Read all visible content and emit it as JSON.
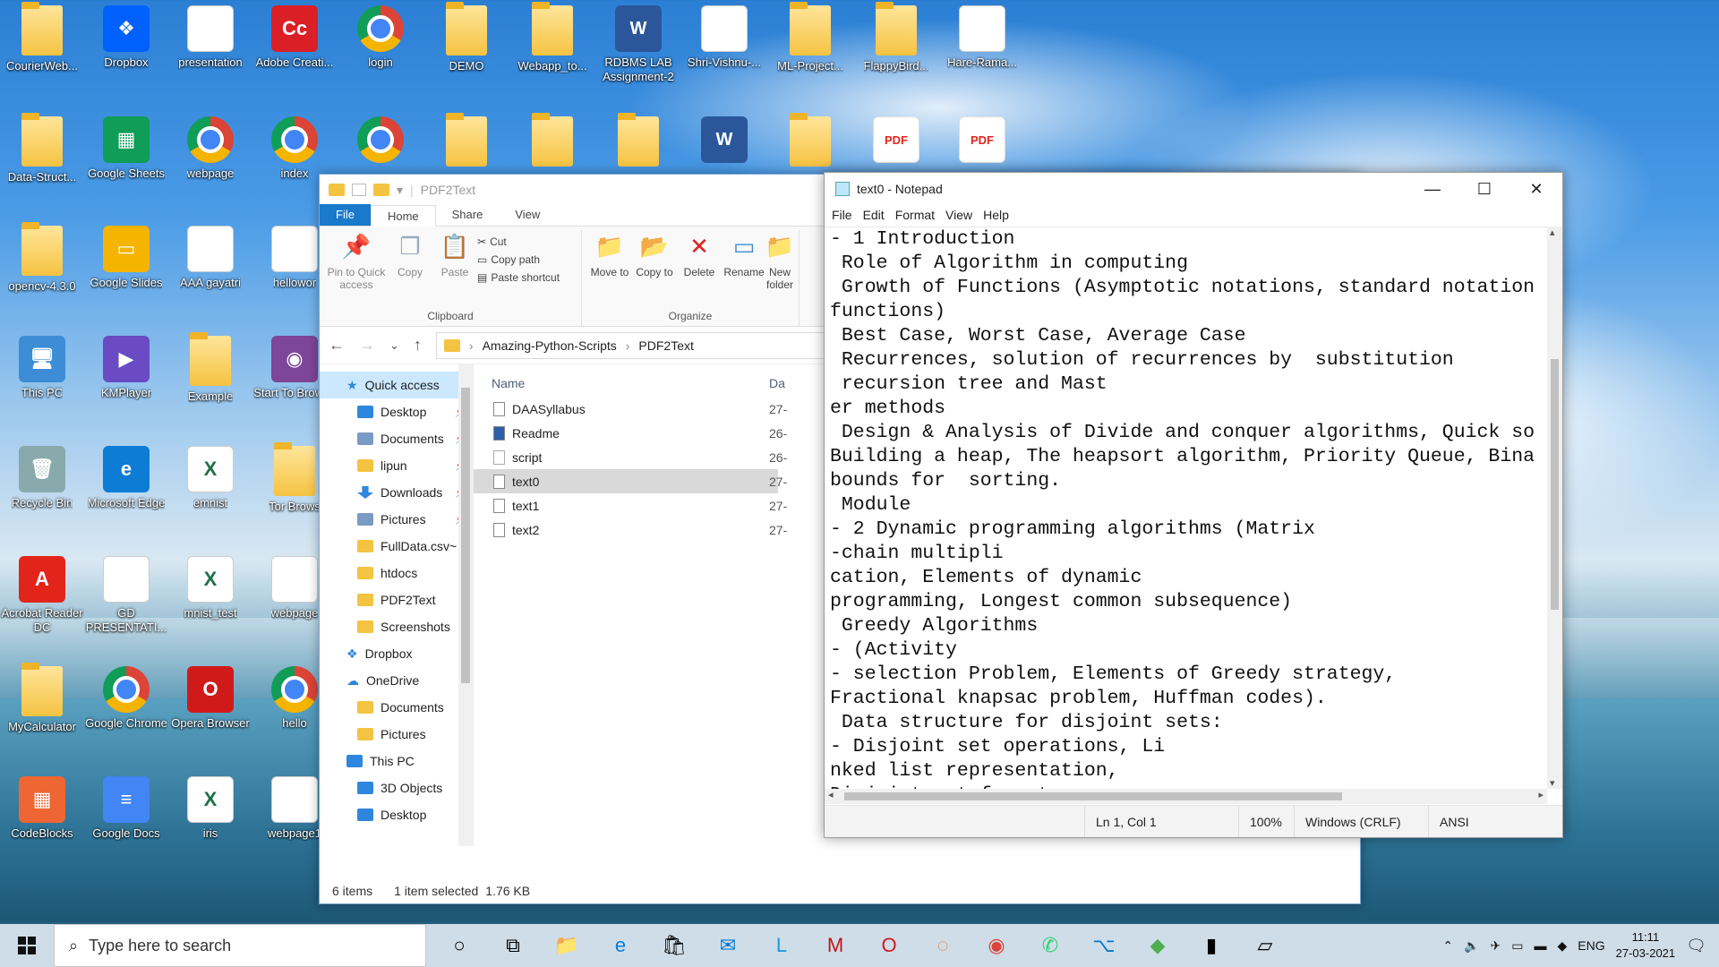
{
  "desktop": {
    "icons": [
      {
        "label": "CourierWeb...",
        "kind": "folder"
      },
      {
        "label": "Dropbox",
        "kind": "dropbox"
      },
      {
        "label": "presentation",
        "kind": "doc"
      },
      {
        "label": "Adobe Creati...",
        "kind": "adobe"
      },
      {
        "label": "login",
        "kind": "chrome"
      },
      {
        "label": "DEMO",
        "kind": "folder"
      },
      {
        "label": "Webapp_to...",
        "kind": "folder"
      },
      {
        "label": "RDBMS LAB Assignment-2",
        "kind": "word"
      },
      {
        "label": "Shri-Vishnu-...",
        "kind": "doc"
      },
      {
        "label": "ML-Project...",
        "kind": "folder"
      },
      {
        "label": "FlappyBird...",
        "kind": "folder"
      },
      {
        "label": "Hare-Rama...",
        "kind": "doc"
      },
      {
        "label": "Data-Struct...",
        "kind": "folder"
      },
      {
        "label": "Google Sheets",
        "kind": "sheets"
      },
      {
        "label": "webpage",
        "kind": "chrome"
      },
      {
        "label": "index",
        "kind": "chrome"
      },
      {
        "label": "",
        "kind": "chrome"
      },
      {
        "label": "",
        "kind": "folder"
      },
      {
        "label": "",
        "kind": "folder"
      },
      {
        "label": "",
        "kind": "folder"
      },
      {
        "label": "",
        "kind": "word"
      },
      {
        "label": "",
        "kind": "folder"
      },
      {
        "label": "",
        "kind": "pdf"
      },
      {
        "label": "",
        "kind": "pdf"
      },
      {
        "label": "opencv-4.3.0",
        "kind": "folder"
      },
      {
        "label": "Google Slides",
        "kind": "slides"
      },
      {
        "label": "AAA gayatri",
        "kind": "doc"
      },
      {
        "label": "hellowor",
        "kind": "doc"
      },
      {
        "label": "This PC",
        "kind": "pc"
      },
      {
        "label": "KMPlayer",
        "kind": "kmp"
      },
      {
        "label": "Example",
        "kind": "folder"
      },
      {
        "label": "Start To Browse",
        "kind": "tor"
      },
      {
        "label": "Recycle Bin",
        "kind": "bin"
      },
      {
        "label": "Microsoft Edge",
        "kind": "edge"
      },
      {
        "label": "emnist",
        "kind": "excel"
      },
      {
        "label": "Tor Brows",
        "kind": "folder"
      },
      {
        "label": "Acrobat Reader DC",
        "kind": "acrobat"
      },
      {
        "label": "GD PRESENTATI...",
        "kind": "doc"
      },
      {
        "label": "mnist_test",
        "kind": "excel"
      },
      {
        "label": "webpage",
        "kind": "doc"
      },
      {
        "label": "MyCalculator",
        "kind": "folder"
      },
      {
        "label": "Google Chrome",
        "kind": "chrome"
      },
      {
        "label": "Opera Browser",
        "kind": "opera"
      },
      {
        "label": "hello",
        "kind": "chrome"
      },
      {
        "label": "CodeBlocks",
        "kind": "codeblocks"
      },
      {
        "label": "Google Docs",
        "kind": "gdocs"
      },
      {
        "label": "iris",
        "kind": "excel"
      },
      {
        "label": "webpage1",
        "kind": "doc"
      }
    ]
  },
  "explorer": {
    "title": "PDF2Text",
    "tabs": [
      "File",
      "Home",
      "Share",
      "View"
    ],
    "ribbon": {
      "clipboard": {
        "group": "Clipboard",
        "pin": "Pin to Quick access",
        "copy": "Copy",
        "paste": "Paste",
        "cut": "Cut",
        "copy_path": "Copy path",
        "paste_shortcut": "Paste shortcut"
      },
      "organize": {
        "group": "Organize",
        "move_to": "Move to",
        "copy_to": "Copy to",
        "delete": "Delete",
        "rename": "Rename",
        "new_folder": "New folder"
      }
    },
    "breadcrumb": [
      "Amazing-Python-Scripts",
      "PDF2Text"
    ],
    "nav": [
      {
        "label": "Quick access",
        "icon": "star",
        "pinned": false,
        "indent": false,
        "selected": true
      },
      {
        "label": "Desktop",
        "icon": "blue",
        "pinned": true,
        "indent": true
      },
      {
        "label": "Documents",
        "icon": "doc",
        "pinned": true,
        "indent": true
      },
      {
        "label": "lipun",
        "icon": "yellow",
        "pinned": true,
        "indent": true
      },
      {
        "label": "Downloads",
        "icon": "dl",
        "pinned": true,
        "indent": true
      },
      {
        "label": "Pictures",
        "icon": "pic",
        "pinned": true,
        "indent": true
      },
      {
        "label": "FullData.csv~",
        "icon": "yellow",
        "pinned": false,
        "indent": true
      },
      {
        "label": "htdocs",
        "icon": "yellow",
        "pinned": false,
        "indent": true
      },
      {
        "label": "PDF2Text",
        "icon": "yellow",
        "pinned": false,
        "indent": true
      },
      {
        "label": "Screenshots",
        "icon": "yellow",
        "pinned": false,
        "indent": true
      },
      {
        "label": "Dropbox",
        "icon": "dropbox",
        "pinned": false,
        "indent": false
      },
      {
        "label": "OneDrive",
        "icon": "cloud",
        "pinned": false,
        "indent": false
      },
      {
        "label": "Documents",
        "icon": "yellow",
        "pinned": false,
        "indent": true
      },
      {
        "label": "Pictures",
        "icon": "yellow",
        "pinned": false,
        "indent": true
      },
      {
        "label": "This PC",
        "icon": "pc",
        "pinned": false,
        "indent": false
      },
      {
        "label": "3D Objects",
        "icon": "blue",
        "pinned": false,
        "indent": true
      },
      {
        "label": "Desktop",
        "icon": "blue",
        "pinned": false,
        "indent": true
      }
    ],
    "columns": {
      "name": "Name",
      "date": "Da"
    },
    "files": [
      {
        "name": "DAASyllabus",
        "date": "27-",
        "selected": false,
        "icon": "pdf"
      },
      {
        "name": "Readme",
        "date": "26-",
        "selected": false,
        "icon": "md"
      },
      {
        "name": "script",
        "date": "26-",
        "selected": false,
        "icon": "py"
      },
      {
        "name": "text0",
        "date": "27-",
        "selected": true,
        "icon": "txt"
      },
      {
        "name": "text1",
        "date": "27-",
        "selected": false,
        "icon": "txt"
      },
      {
        "name": "text2",
        "date": "27-",
        "selected": false,
        "icon": "txt"
      }
    ],
    "status": {
      "items": "6 items",
      "selected": "1 item selected",
      "size": "1.76 KB"
    }
  },
  "notepad": {
    "title": "text0 - Notepad",
    "menu": [
      "File",
      "Edit",
      "Format",
      "View",
      "Help"
    ],
    "lines": [
      "- 1 Introduction",
      " Role of Algorithm in computing",
      " Growth of Functions (Asymptotic notations, standard notation",
      "functions)",
      " Best Case, Worst Case, Average Case",
      " Recurrences, solution of recurrences by  substitution",
      " recursion tree and Mast",
      "er methods",
      " Design & Analysis of Divide and conquer algorithms, Quick so",
      "Building a heap, The heapsort algorithm, Priority Queue, Bina",
      "bounds for  sorting.",
      " Module",
      "- 2 Dynamic programming algorithms (Matrix",
      "-chain multipli",
      "cation, Elements of dynamic",
      "programming, Longest common subsequence)",
      " Greedy Algorithms",
      "- (Activity",
      "- selection Problem, Elements of Greedy strategy,",
      "Fractional knapsac problem, Huffman codes).",
      " Data structure for disjoint sets:",
      "- Disjoint set operations, Li",
      "nked list representation,",
      "Disjoint set forest."
    ],
    "status": {
      "position": "Ln 1, Col 1",
      "zoom": "100%",
      "eol": "Windows (CRLF)",
      "encoding": "ANSI"
    }
  },
  "taskbar": {
    "search_placeholder": "Type here to search",
    "apps": [
      "cortana",
      "task-view",
      "file-explorer",
      "edge",
      "store",
      "mail",
      "l-app",
      "mcafee",
      "opera",
      "jupyter",
      "chrome",
      "whatsapp",
      "vscode",
      "git",
      "terminal",
      "notepad"
    ],
    "language": "ENG",
    "time": "11:11",
    "date": "27-03-2021"
  }
}
